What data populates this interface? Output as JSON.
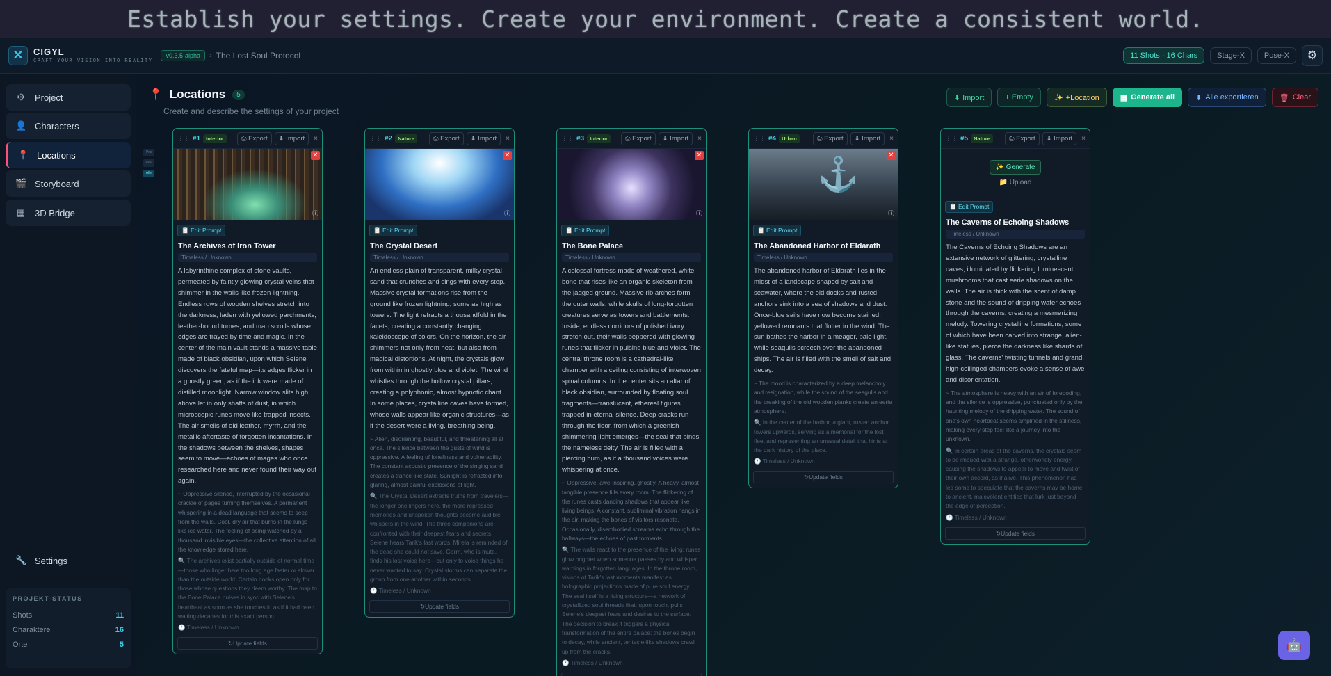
{
  "banner": {
    "text": "Establish your settings. Create your environment. Create a consistent world."
  },
  "header": {
    "brand_name": "CIGYL",
    "brand_tagline": "CRAFT YOUR VISION INTO REALITY",
    "version": "v0.3.5-alpha",
    "separator": "›",
    "project_name": "The Lost Soul Protocol",
    "status_pill": "11 Shots · 16 Chars",
    "stage_label": "Stage-X",
    "pose_label": "Pose-X"
  },
  "sidebar": {
    "items": [
      {
        "label": "Project",
        "icon": "gear-icon"
      },
      {
        "label": "Characters",
        "icon": "person-icon"
      },
      {
        "label": "Locations",
        "icon": "pin-icon"
      },
      {
        "label": "Storyboard",
        "icon": "film-icon"
      },
      {
        "label": "3D Bridge",
        "icon": "cube-icon"
      }
    ],
    "settings_label": "Settings",
    "status": {
      "title": "PROJEKT-STATUS",
      "rows": [
        {
          "label": "Shots",
          "value": "11"
        },
        {
          "label": "Charaktere",
          "value": "16"
        },
        {
          "label": "Orte",
          "value": "5"
        }
      ]
    }
  },
  "main": {
    "title": "Locations",
    "count": "5",
    "subtitle": "Create and describe the settings of your project",
    "actions": {
      "import": "⬇ Import",
      "empty": "+ Empty",
      "location": "✨ +Location",
      "generate_all": "Generate all",
      "export_all": "Alle exportieren",
      "clear": "Clear"
    },
    "mini_tabs": [
      "Pos",
      "Rev",
      "Alle"
    ]
  },
  "card_labels": {
    "export": "Export",
    "import": "Import",
    "close": "×",
    "edit_prompt": "Edit Prompt",
    "update": "↻Update fields",
    "generate": "Generate",
    "upload": "Upload"
  },
  "cards": [
    {
      "num": "#1",
      "type": "Interior",
      "title": "The Archives of Iron Tower",
      "time": "Timeless / Unknown",
      "desc": "A labyrinthine complex of stone vaults, permeated by faintly glowing crystal veins that shimmer in the walls like frozen lightning. Endless rows of wooden shelves stretch into the darkness, laden with yellowed parchments, leather-bound tomes, and map scrolls whose edges are frayed by time and magic. In the center of the main vault stands a massive table made of black obsidian, upon which Selene discovers the fateful map—its edges flicker in a ghostly green, as if the ink were made of distilled moonlight. Narrow window slits high above let in only shafts of dust, in which microscopic runes move like trapped insects. The air smells of old leather, myrrh, and the metallic aftertaste of forgotten incantations. In the shadows between the shelves, shapes seem to move—echoes of mages who once researched here and never found their way out again.",
      "mood": "~ Oppressive silence, interrupted by the occasional crackle of pages turning themselves. A permanent whispering in a dead language that seems to seep from the walls. Cool, dry air that burns in the lungs like ice water. The feeling of being watched by a thousand invisible eyes—the collective attention of all the knowledge stored here.",
      "secret": "🔍 The archives exist partially outside of normal time—those who linger here too long age faster or slower than the outside world. Certain books open only for those whose questions they deem worthy. The map to the Bone Palace pulses in sync with Selene's heartbeat as soon as she touches it, as if it had been waiting decades for this exact person.",
      "time_foot": "🕐 Timeless / Unknown"
    },
    {
      "num": "#2",
      "type": "Nature",
      "title": "The Crystal Desert",
      "time": "Timeless / Unknown",
      "desc": "An endless plain of transparent, milky crystal sand that crunches and sings with every step. Massive crystal formations rise from the ground like frozen lightning, some as high as towers. The light refracts a thousandfold in the facets, creating a constantly changing kaleidoscope of colors. On the horizon, the air shimmers not only from heat, but also from magical distortions. At night, the crystals glow from within in ghostly blue and violet. The wind whistles through the hollow crystal pillars, creating a polyphonic, almost hypnotic chant. In some places, crystalline caves have formed, whose walls appear like organic structures—as if the desert were a living, breathing being.",
      "mood": "~ Alien, disorienting, beautiful, and threatening all at once. The silence between the gusts of wind is oppressive. A feeling of loneliness and vulnerability. The constant acoustic presence of the singing sand creates a trance-like state. Sunlight is refracted into glaring, almost painful explosions of light.",
      "secret": "🔍 The Crystal Desert extracts truths from travelers—the longer one lingers here, the more repressed memories and unspoken thoughts become audible whispers in the wind. The three companions are confronted with their deepest fears and secrets. Selene hears Tarik's last words. Mirela is reminded of the dead she could not save. Gorm, who is mute, finds his lost voice here—but only to voice things he never wanted to say. Crystal storms can separate the group from one another within seconds.",
      "time_foot": "🕐 Timeless / Unknown"
    },
    {
      "num": "#3",
      "type": "Interior",
      "title": "The Bone Palace",
      "time": "Timeless / Unknown",
      "desc": "A colossal fortress made of weathered, white bone that rises like an organic skeleton from the jagged ground. Massive rib arches form the outer walls, while skulls of long-forgotten creatures serve as towers and battlements. Inside, endless corridors of polished ivory stretch out, their walls peppered with glowing runes that flicker in pulsing blue and violet. The central throne room is a cathedral-like chamber with a ceiling consisting of interwoven spinal columns. In the center sits an altar of black obsidian, surrounded by floating soul fragments—translucent, ethereal figures trapped in eternal silence. Deep cracks run through the floor, from which a greenish shimmering light emerges—the seal that binds the nameless deity. The air is filled with a piercing hum, as if a thousand voices were whispering at once.",
      "mood": "~ Oppressive, awe-inspiring, ghostly. A heavy, almost tangible presence fills every room. The flickering of the runes casts dancing shadows that appear like living beings. A constant, subliminal vibration hangs in the air, making the bones of visitors resonate. Occasionally, disembodied screams echo through the hallways—the echoes of past torments.",
      "secret": "🔍 The walls react to the presence of the living: runes glow brighter when someone passes by and whisper warnings in forgotten languages. In the throne room, visions of Tarik's last moments manifest as holographic projections made of pure soul energy. The seal itself is a living structure—a network of crystallized soul threads that, upon touch, pulls Selene's deepest fears and desires to the surface. The decision to break it triggers a physical transformation of the entire palace: the bones begin to decay, while ancient, tentacle-like shadows crawl up from the cracks.",
      "time_foot": "🕐 Timeless / Unknown"
    },
    {
      "num": "#4",
      "type": "Urban",
      "title": "The Abandoned Harbor of Eldarath",
      "time": "Timeless / Unknown",
      "desc": "The abandoned harbor of Eldarath lies in the midst of a landscape shaped by salt and seawater, where the old docks and rusted anchors sink into a sea of shadows and dust. Once-blue sails have now become stained, yellowed remnants that flutter in the wind. The sun bathes the harbor in a meager, pale light, while seagulls screech over the abandoned ships. The air is filled with the smell of salt and decay.",
      "mood": "~ The mood is characterized by a deep melancholy and resignation, while the sound of the seagulls and the creaking of the old wooden planks create an eerie atmosphere.",
      "secret": "🔍 In the center of the harbor, a giant, rusted anchor towers upwards, serving as a memorial for the lost fleet and representing an unusual detail that hints at the dark history of the place.",
      "time_foot": "🕐 Timeless / Unknown"
    },
    {
      "num": "#5",
      "type": "Nature",
      "title": "The Caverns of Echoing Shadows",
      "time": "Timeless / Unknown",
      "desc": "The Caverns of Echoing Shadows are an extensive network of glittering, crystalline caves, illuminated by flickering luminescent mushrooms that cast eerie shadows on the walls. The air is thick with the scent of damp stone and the sound of dripping water echoes through the caverns, creating a mesmerizing melody. Towering crystalline formations, some of which have been carved into strange, alien-like statues, pierce the darkness like shards of glass. The caverns' twisting tunnels and grand, high-ceilinged chambers evoke a sense of awe and disorientation.",
      "mood": "~ The atmosphere is heavy with an air of foreboding, and the silence is oppressive, punctuated only by the haunting melody of the dripping water. The sound of one's own heartbeat seems amplified in the stillness, making every step feel like a journey into the unknown.",
      "secret": "🔍 In certain areas of the caverns, the crystals seem to be imbued with a strange, otherworldly energy, causing the shadows to appear to move and twist of their own accord, as if alive. This phenomenon has led some to speculate that the caverns may be home to ancient, malevolent entities that lurk just beyond the edge of perception.",
      "time_foot": "🕐 Timeless / Unknown"
    }
  ],
  "colors": {
    "accent": "#1cb58c",
    "active": "#ff4f7b",
    "cyan": "#39d3ee"
  }
}
